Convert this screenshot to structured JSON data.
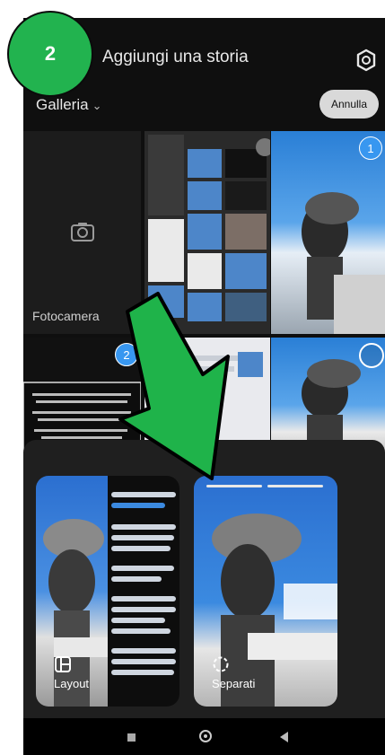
{
  "header": {
    "title": "Aggiungi una storia"
  },
  "gallery": {
    "label": "Galleria",
    "cancel_label": "Annulla"
  },
  "tiles": {
    "camera_label": "Fotocamera",
    "badge_1": "1",
    "badge_2": "2"
  },
  "layout_options": {
    "layout_label": "Layout",
    "separate_label": "Separati"
  },
  "overlay": {
    "step_number": "2",
    "arrow_color": "#1fb34a"
  },
  "colors": {
    "accent": "#3897f0",
    "sheet": "#1f1f1f",
    "background": "#0f0f0f"
  }
}
